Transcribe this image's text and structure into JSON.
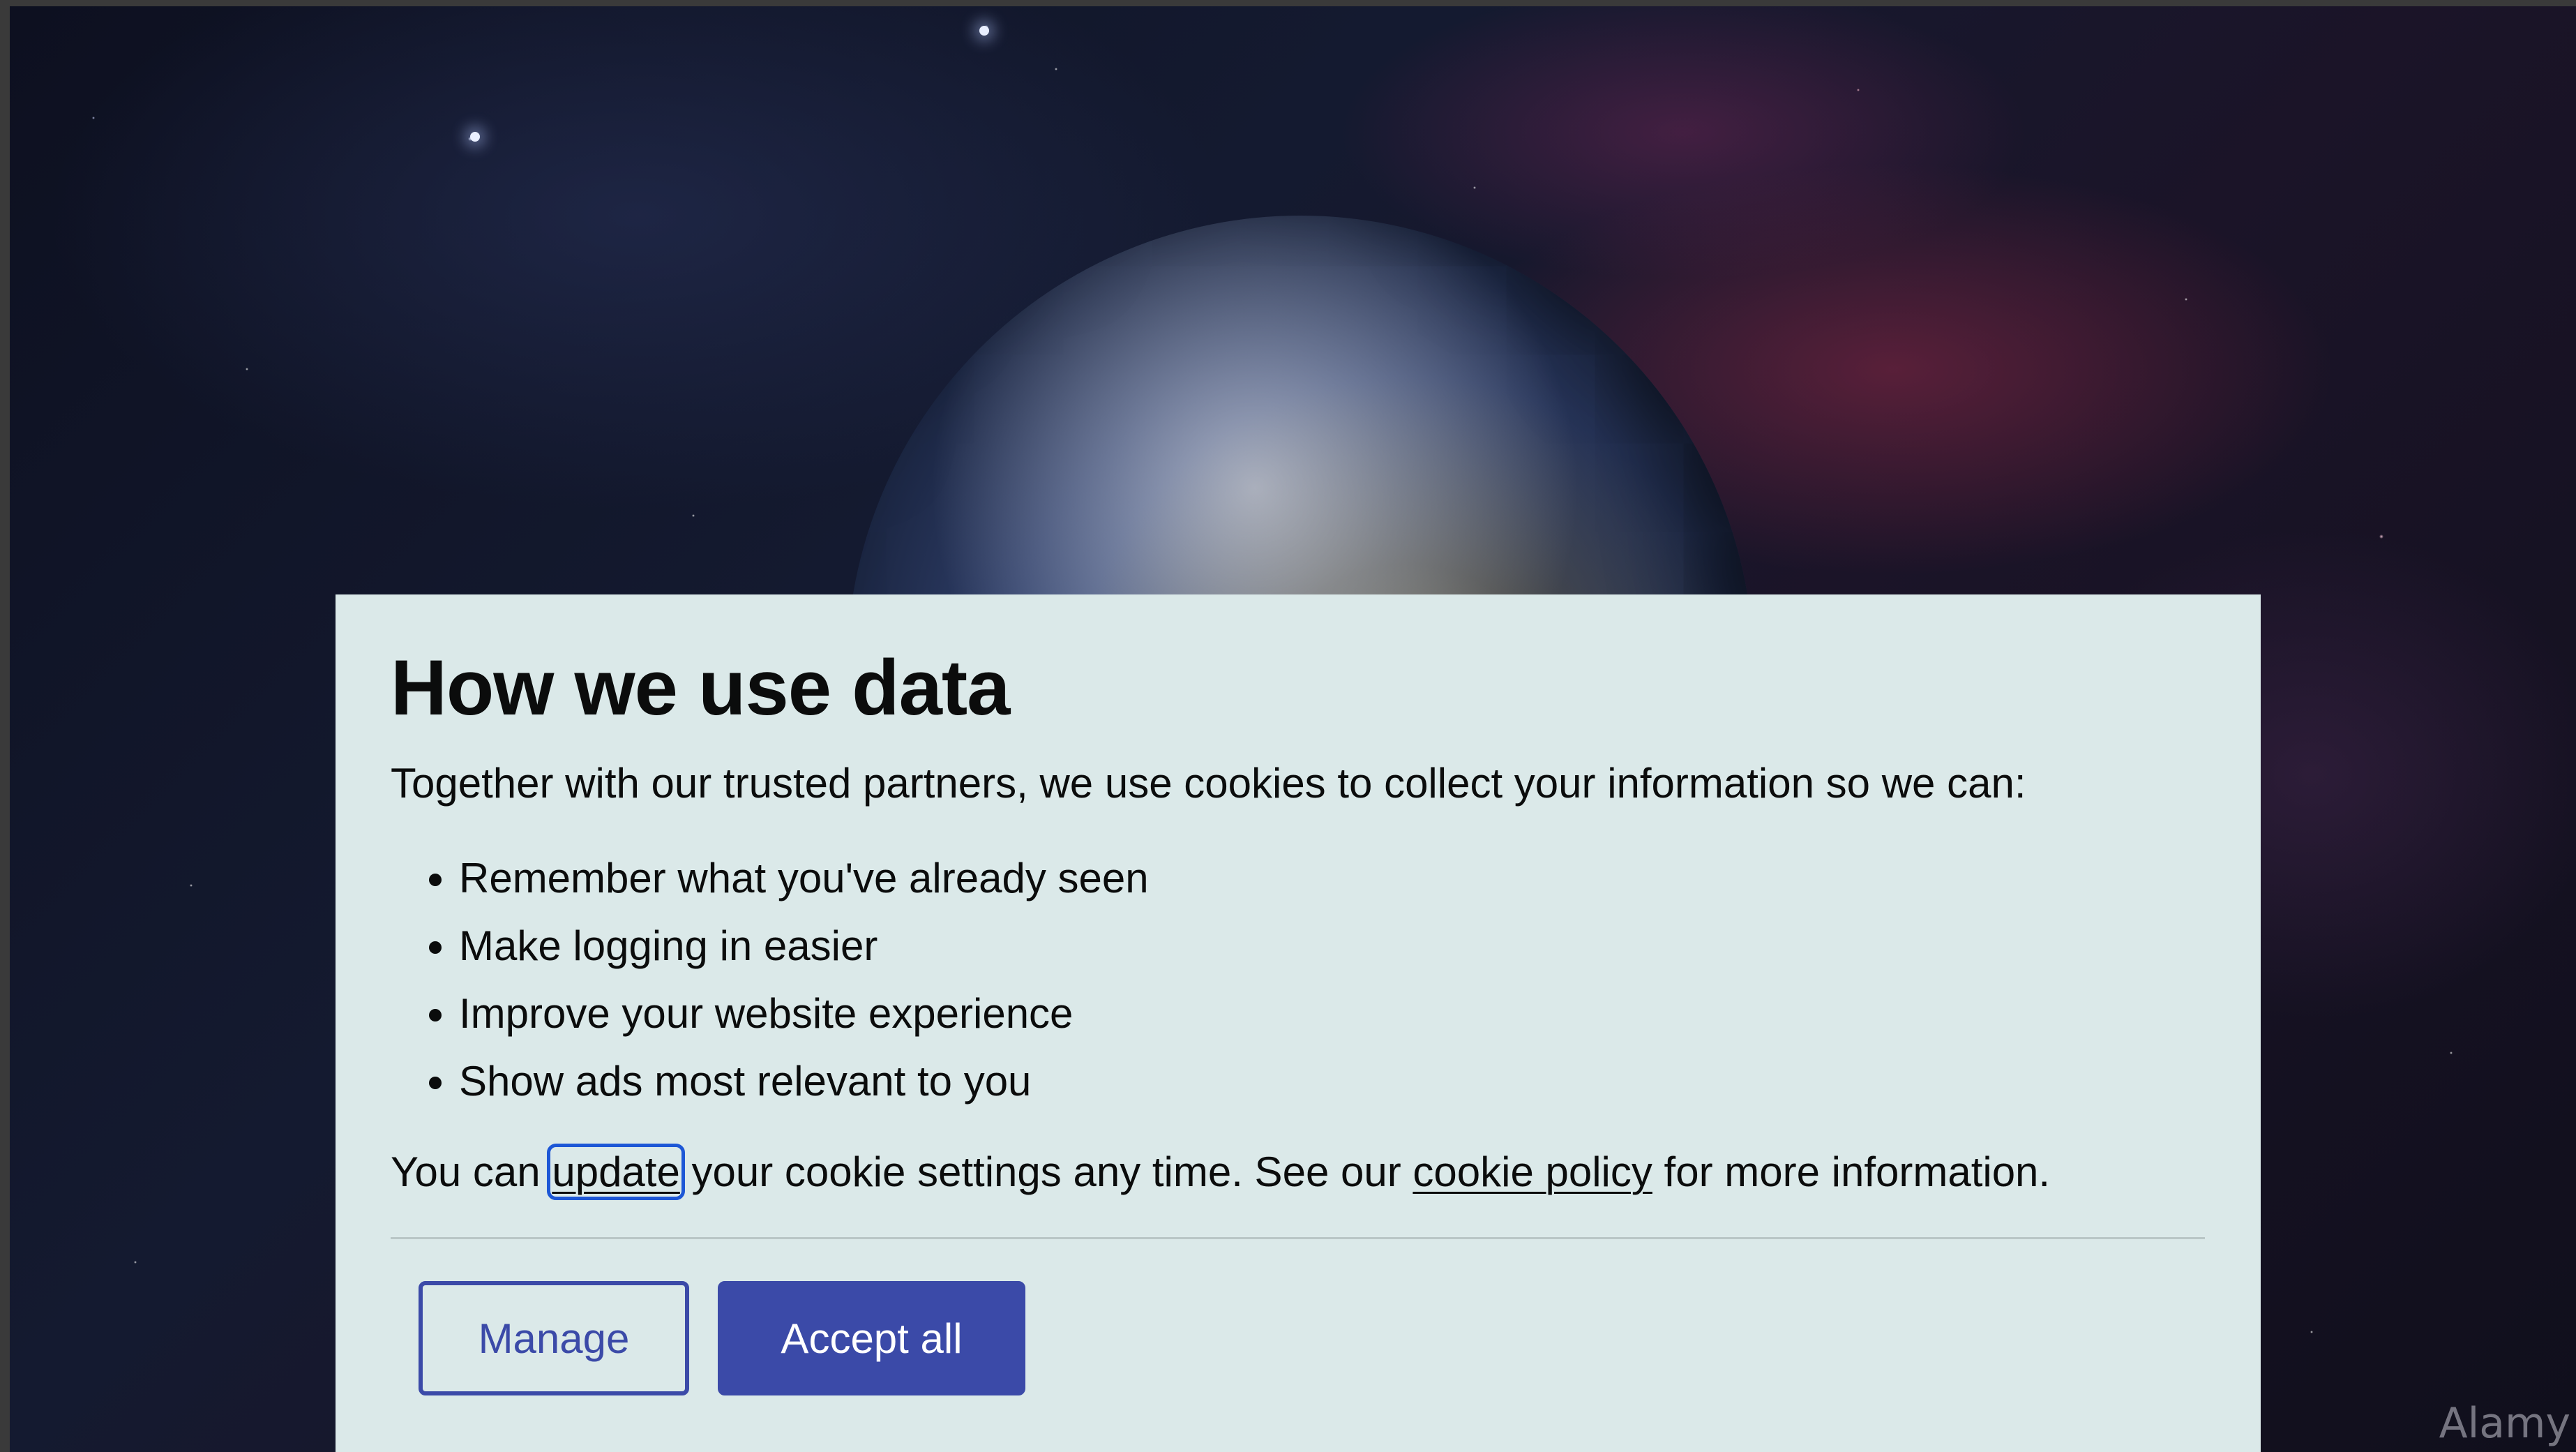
{
  "background": {
    "watermark": "Alamy"
  },
  "consent": {
    "title": "How we use data",
    "intro": "Together with our trusted partners, we use cookies to collect your information so we can:",
    "purposes": [
      "Remember what you've already seen",
      "Make logging in easier",
      "Improve your website experience",
      "Show ads most relevant to you"
    ],
    "settings_prefix": "You can ",
    "update_link": "update",
    "settings_middle": " your cookie settings any time. See our ",
    "policy_link": "cookie policy",
    "settings_suffix": " for more information.",
    "manage_label": "Manage",
    "accept_label": "Accept all"
  },
  "colors": {
    "modal_bg": "#dbe9e9",
    "brand": "#3b4aa8",
    "focus": "#1d57d6"
  }
}
